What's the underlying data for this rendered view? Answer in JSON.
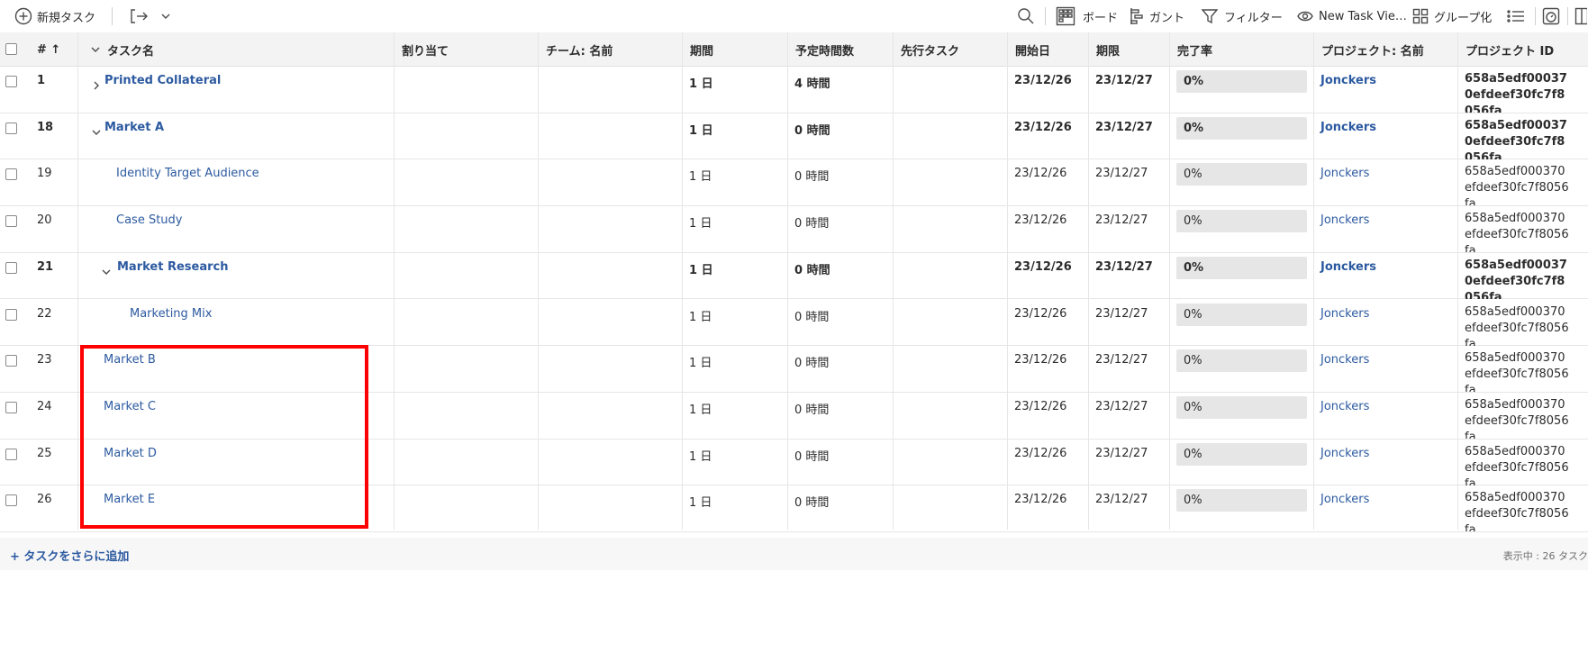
{
  "toolbar": {
    "new_task": "新規タスク",
    "board": "ボード",
    "gantt": "ガント",
    "filter": "フィルター",
    "view": "New Task Vie…",
    "group": "グループ化"
  },
  "columns": {
    "num": "# ↑",
    "task_name": "タスク名",
    "assignee": "割り当て",
    "team": "チーム: 名前",
    "duration": "期間",
    "planned_hours": "予定時間数",
    "predecessor": "先行タスク",
    "start": "開始日",
    "due": "期限",
    "percent": "完了率",
    "project_name": "プロジェクト: 名前",
    "project_id": "プロジェクト ID"
  },
  "rows": [
    {
      "num": "1",
      "name": "Printed Collateral",
      "duration": "1 日",
      "hours": "4 時間",
      "start": "23/12/26",
      "due": "23/12/27",
      "pct": "0%",
      "project": "Jonckers",
      "pid": "658a5edf000370efdeef30fc7f8056fa"
    },
    {
      "num": "18",
      "name": "Market A",
      "duration": "1 日",
      "hours": "0 時間",
      "start": "23/12/26",
      "due": "23/12/27",
      "pct": "0%",
      "project": "Jonckers",
      "pid": "658a5edf000370efdeef30fc7f8056fa"
    },
    {
      "num": "19",
      "name": "Identity Target Audience",
      "duration": "1 日",
      "hours": "0 時間",
      "start": "23/12/26",
      "due": "23/12/27",
      "pct": "0%",
      "project": "Jonckers",
      "pid": "658a5edf000370efdeef30fc7f8056fa"
    },
    {
      "num": "20",
      "name": "Case Study",
      "duration": "1 日",
      "hours": "0 時間",
      "start": "23/12/26",
      "due": "23/12/27",
      "pct": "0%",
      "project": "Jonckers",
      "pid": "658a5edf000370efdeef30fc7f8056fa"
    },
    {
      "num": "21",
      "name": "Market Research",
      "duration": "1 日",
      "hours": "0 時間",
      "start": "23/12/26",
      "due": "23/12/27",
      "pct": "0%",
      "project": "Jonckers",
      "pid": "658a5edf000370efdeef30fc7f8056fa"
    },
    {
      "num": "22",
      "name": "Marketing Mix",
      "duration": "1 日",
      "hours": "0 時間",
      "start": "23/12/26",
      "due": "23/12/27",
      "pct": "0%",
      "project": "Jonckers",
      "pid": "658a5edf000370efdeef30fc7f8056fa"
    },
    {
      "num": "23",
      "name": "Market B",
      "duration": "1 日",
      "hours": "0 時間",
      "start": "23/12/26",
      "due": "23/12/27",
      "pct": "0%",
      "project": "Jonckers",
      "pid": "658a5edf000370efdeef30fc7f8056fa"
    },
    {
      "num": "24",
      "name": "Market C",
      "duration": "1 日",
      "hours": "0 時間",
      "start": "23/12/26",
      "due": "23/12/27",
      "pct": "0%",
      "project": "Jonckers",
      "pid": "658a5edf000370efdeef30fc7f8056fa"
    },
    {
      "num": "25",
      "name": "Market D",
      "duration": "1 日",
      "hours": "0 時間",
      "start": "23/12/26",
      "due": "23/12/27",
      "pct": "0%",
      "project": "Jonckers",
      "pid": "658a5edf000370efdeef30fc7f8056fa"
    },
    {
      "num": "26",
      "name": "Market E",
      "duration": "1 日",
      "hours": "0 時間",
      "start": "23/12/26",
      "due": "23/12/27",
      "pct": "0%",
      "project": "Jonckers",
      "pid": "658a5edf000370efdeef30fc7f8056fa"
    }
  ],
  "footer": {
    "add_more": "+ タスクをさらに追加",
    "showing": "表示中 : 26 タスク"
  },
  "colors": {
    "link": "#2c5aa0",
    "highlight": "#ff0000"
  }
}
